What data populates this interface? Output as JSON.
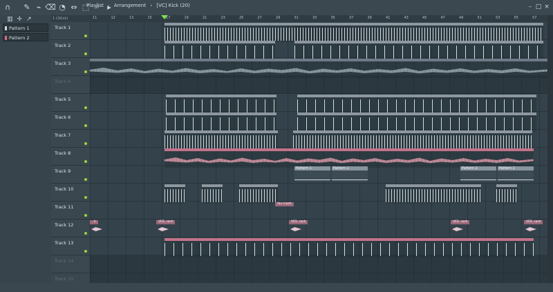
{
  "window": {
    "title_parts": [
      "Playlist",
      "-",
      "Arrangement",
      "›",
      "[VC] Kick (20)"
    ]
  },
  "toolbar_icons": [
    "magnet-icon",
    "draw-icon",
    "paint-icon",
    "delete-icon",
    "mute-icon",
    "slip-icon",
    "slice-icon",
    "select-icon",
    "zoom-icon",
    "play-icon"
  ],
  "left_panel": {
    "patterns": [
      "Pattern 1",
      "Pattern 2"
    ],
    "plus": "+"
  },
  "track_header_top": "1 (1Kick)",
  "tracks": [
    {
      "name": "Track 1",
      "active": true
    },
    {
      "name": "Track 2",
      "active": true
    },
    {
      "name": "Track 3",
      "active": true
    },
    {
      "name": "Track 4",
      "active": false
    },
    {
      "name": "Track 5",
      "active": true
    },
    {
      "name": "Track 6",
      "active": true
    },
    {
      "name": "Track 7",
      "active": true
    },
    {
      "name": "Track 8",
      "active": true
    },
    {
      "name": "Track 9",
      "active": true
    },
    {
      "name": "Track 10",
      "active": true
    },
    {
      "name": "Track 11",
      "active": true
    },
    {
      "name": "Track 12",
      "active": true
    },
    {
      "name": "Track 13",
      "active": true
    },
    {
      "name": "Track 14",
      "active": false
    },
    {
      "name": "Track 15",
      "active": false
    }
  ],
  "timeline_ticks": [
    "11",
    "12",
    "13",
    "15",
    "17",
    "19",
    "21",
    "23",
    "25",
    "27",
    "29",
    "31",
    "33",
    "35",
    "37",
    "39",
    "41",
    "43",
    "45",
    "47",
    "49",
    "51",
    "53",
    "55",
    "57"
  ],
  "clips": {
    "track3_labels": [
      "Tera..AUD",
      "Tera..AUD",
      "Tera_AUD",
      "Tera_Mono_XLEXAUD",
      "Tera_Mono_Xcell",
      "Tera_Mono_XLEXAUD",
      "Tera_M_EXAUD",
      "Tera_Mo_EXAUD"
    ],
    "track8_label": "7",
    "pattern1": "Pattern 1",
    "pattern2": "Pattern 2",
    "mukhra": "MUKHRA2",
    "fav_crash": "fav crash",
    "ves_rash": "VES..rash",
    "ves_short": "..h"
  }
}
